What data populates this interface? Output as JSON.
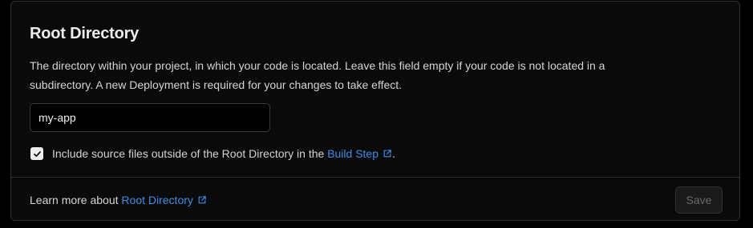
{
  "section": {
    "title": "Root Directory",
    "description": "The directory within your project, in which your code is located. Leave this field empty if your code is not located in a subdirectory. A new Deployment is required for your changes to take effect."
  },
  "root_directory_input": {
    "value": "my-app"
  },
  "include_source_files": {
    "checked": true,
    "label_prefix": "Include source files outside of the Root Directory in the ",
    "link_text": "Build Step",
    "label_suffix": "."
  },
  "footer": {
    "learn_more_prefix": "Learn more about ",
    "learn_more_link": "Root Directory",
    "save_label": "Save"
  },
  "colors": {
    "link": "#3b8eea",
    "background": "#0a0a0a",
    "border": "#2e2e2e"
  },
  "icons": {
    "checkbox": "check-icon",
    "external": "external-link-icon"
  }
}
